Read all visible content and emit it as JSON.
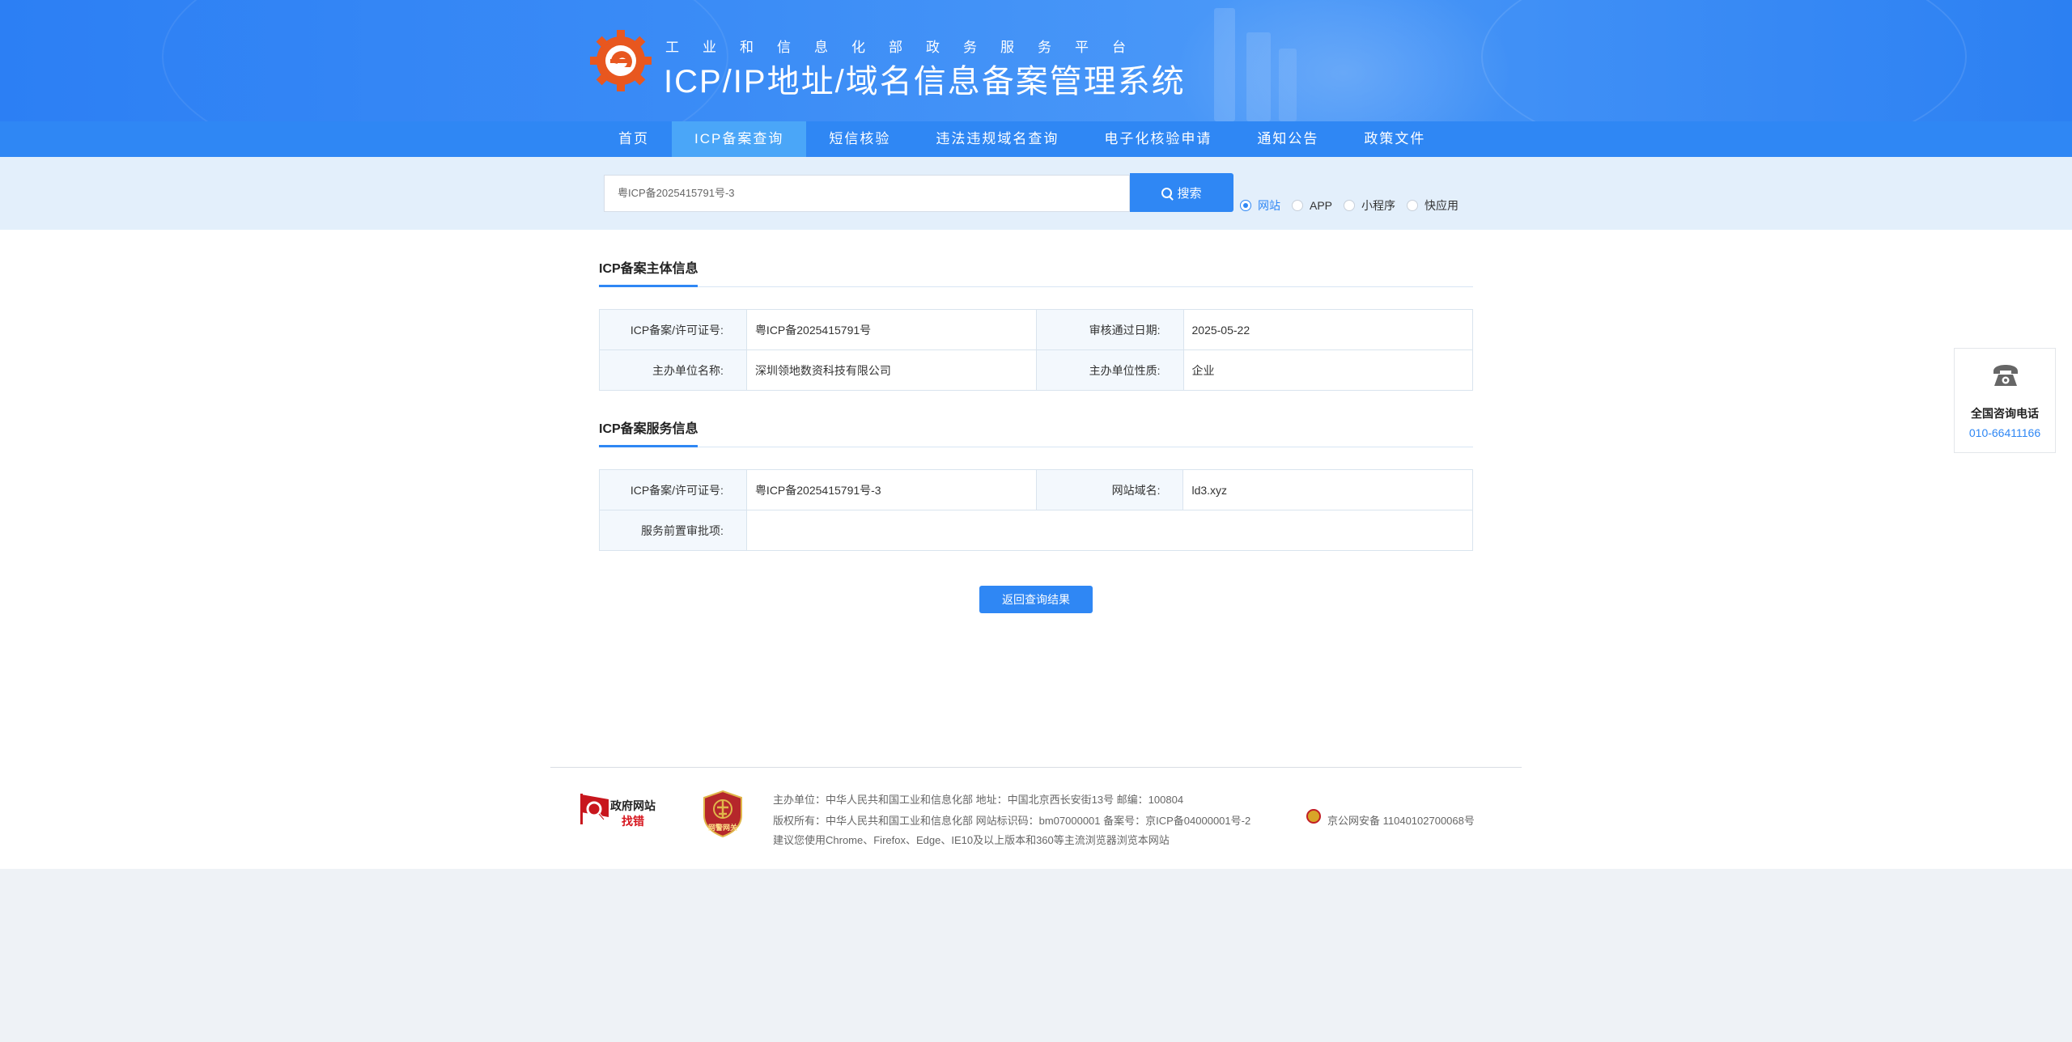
{
  "header": {
    "sub_title": "工业和信息化部政务服务平台",
    "main_title": "ICP/IP地址/域名信息备案管理系统"
  },
  "nav": {
    "items": [
      {
        "label": "首页",
        "active": false
      },
      {
        "label": "ICP备案查询",
        "active": true
      },
      {
        "label": "短信核验",
        "active": false
      },
      {
        "label": "违法违规域名查询",
        "active": false
      },
      {
        "label": "电子化核验申请",
        "active": false
      },
      {
        "label": "通知公告",
        "active": false
      },
      {
        "label": "政策文件",
        "active": false
      }
    ]
  },
  "search": {
    "value": "粤ICP备2025415791号-3",
    "button_label": "搜索",
    "icon": "search-icon",
    "options": [
      {
        "label": "网站",
        "checked": true
      },
      {
        "label": "APP",
        "checked": false
      },
      {
        "label": "小程序",
        "checked": false
      },
      {
        "label": "快应用",
        "checked": false
      }
    ]
  },
  "subject": {
    "title": "ICP备案主体信息",
    "license_label": "ICP备案/许可证号:",
    "license_value": "粤ICP备2025415791号",
    "approve_date_label": "审核通过日期:",
    "approve_date_value": "2025-05-22",
    "org_name_label": "主办单位名称:",
    "org_name_value": "深圳领地数资科技有限公司",
    "org_type_label": "主办单位性质:",
    "org_type_value": "企业"
  },
  "service": {
    "title": "ICP备案服务信息",
    "license_label": "ICP备案/许可证号:",
    "license_value": "粤ICP备2025415791号-3",
    "domain_label": "网站域名:",
    "domain_value": "ld3.xyz",
    "preapproval_label": "服务前置审批项:",
    "preapproval_value": ""
  },
  "back_button_label": "返回查询结果",
  "footer": {
    "gov_badge_line1": "政府网站",
    "gov_badge_line2": "找错",
    "police_badge_label": "网警网关",
    "line1": "主办单位：中华人民共和国工业和信息化部    地址：中国北京西长安街13号    邮编：100804",
    "line2_a": "版权所有：中华人民共和国工业和信息化部    网站标识码：bm07000001    备案号：京ICP备04000001号-2",
    "line2_b": "京公网安备 11040102700068号",
    "line3": "建议您使用Chrome、Firefox、Edge、IE10及以上版本和360等主流浏览器浏览本网站"
  },
  "contact": {
    "title": "全国咨询电话",
    "number": "010-66411166",
    "icon": "phone-icon"
  },
  "colors": {
    "primary": "#2f87f4",
    "nav_active": "#4aa6f8",
    "header_bg": "#3b8cf6",
    "label_bg": "#f3f8fd"
  }
}
